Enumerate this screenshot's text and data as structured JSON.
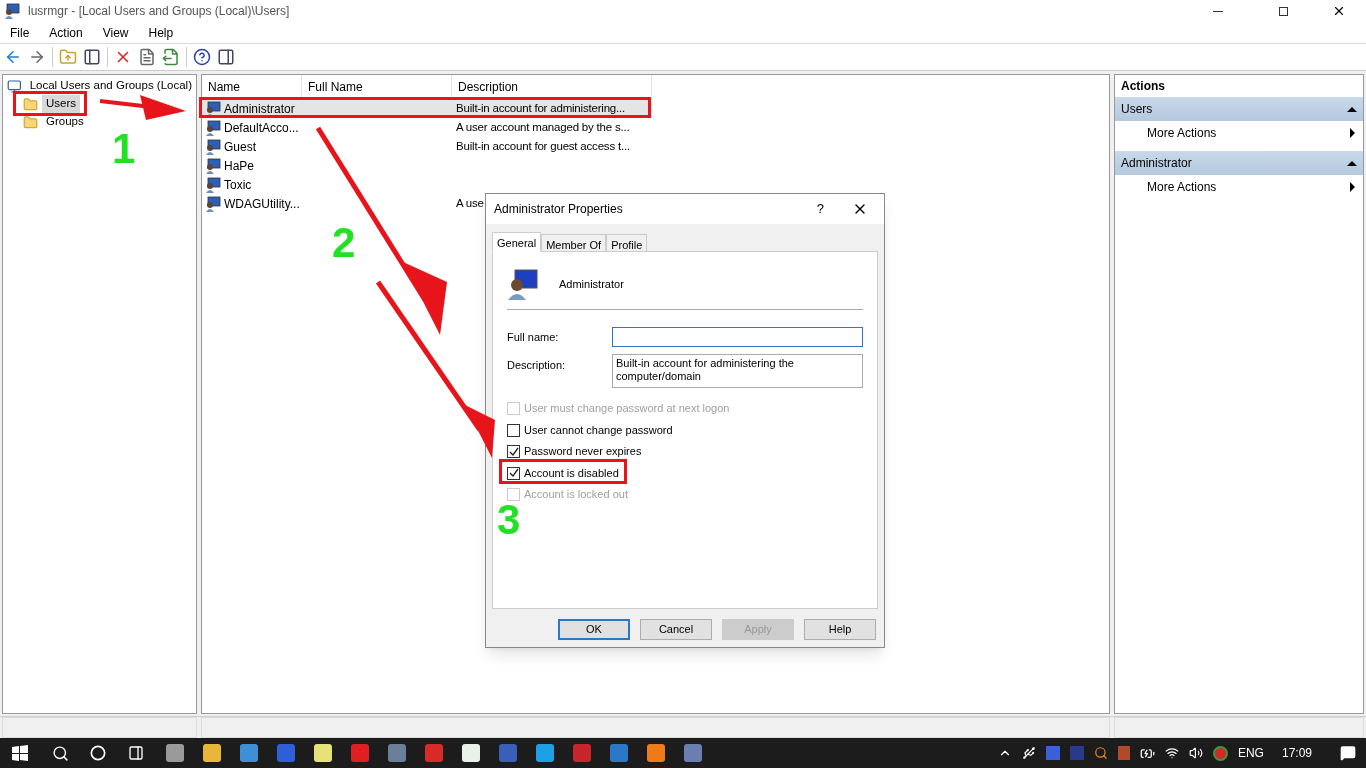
{
  "window": {
    "title": "lusrmgr - [Local Users and Groups (Local)\\Users]"
  },
  "menu": [
    "File",
    "Action",
    "View",
    "Help"
  ],
  "tree": [
    {
      "label": "Local Users and Groups (Local)",
      "selected": false,
      "children": [
        {
          "label": "Users",
          "selected": true
        },
        {
          "label": "Groups",
          "selected": false
        }
      ]
    }
  ],
  "table": {
    "columns": [
      "Name",
      "Full Name",
      "Description"
    ],
    "rows": [
      {
        "name": "Administrator",
        "full_name": "",
        "description": "Built-in account for administering...",
        "selected": true
      },
      {
        "name": "DefaultAcco...",
        "description": "A user account managed by the s...",
        "selected": false
      },
      {
        "name": "Guest",
        "description": "Built-in account for guest access t...",
        "selected": false
      },
      {
        "name": "HaPe",
        "selected": false
      },
      {
        "name": "Toxic",
        "selected": false
      },
      {
        "name": "WDAGUtility...",
        "description": "A use",
        "selected": false
      }
    ]
  },
  "actions": {
    "title": "Actions",
    "sections": [
      {
        "title": "Users",
        "items": [
          "More Actions"
        ]
      },
      {
        "title": "Administrator",
        "items": [
          "More Actions"
        ]
      }
    ]
  },
  "dialog": {
    "title": "Administrator Properties",
    "help": "?",
    "tabs": [
      {
        "label": "General",
        "selected": true
      },
      {
        "label": "Member Of",
        "selected": false
      },
      {
        "label": "Profile",
        "selected": false
      }
    ],
    "user_name": "Administrator",
    "full_name": {
      "label": "Full name:",
      "focused": true
    },
    "description": {
      "label": "Description:",
      "value": "Built-in account for administering the computer/domain"
    },
    "checkboxes": [
      {
        "label": "User must change password at next logon",
        "checked": false,
        "disabled": true
      },
      {
        "label": "User cannot change password",
        "checked": false,
        "disabled": false
      },
      {
        "label": "Password never expires",
        "checked": true,
        "disabled": false
      },
      {
        "label": "Account is disabled",
        "checked": true,
        "disabled": false
      },
      {
        "label": "Account is locked out",
        "checked": false,
        "disabled": true
      }
    ],
    "buttons": [
      {
        "label": "OK",
        "default": true,
        "disabled": false
      },
      {
        "label": "Cancel",
        "default": false,
        "disabled": false
      },
      {
        "label": "Apply",
        "default": false,
        "disabled": true
      },
      {
        "label": "Help",
        "default": false,
        "disabled": false
      }
    ]
  },
  "annotations": [
    "1",
    "2",
    "3"
  ],
  "tray": {
    "language": "ENG",
    "time": "17:09"
  }
}
